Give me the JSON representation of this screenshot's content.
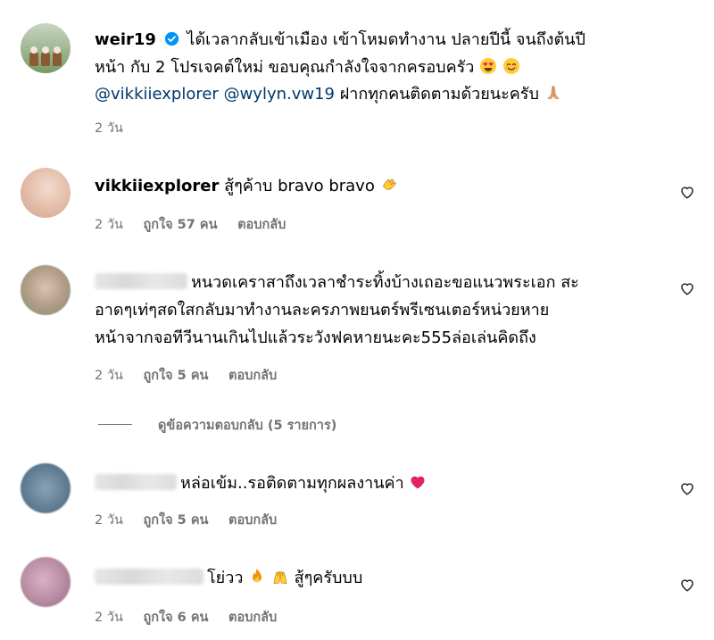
{
  "post": {
    "username": "weir19",
    "caption_line1": "ได้เวลากลับเข้าเมือง เข้าโหมดทำงาน ปลายปีนี้ จนถึงต้นปี",
    "caption_line2": "หน้า กับ 2 โปรเจคต์ใหม่ ขอบคุณกำลังใจจากครอบครัว",
    "mention1": "@vikkiiexplorer",
    "mention2": "@wylyn.vw19",
    "caption_line3_rest": "ฝากทุกคนติดตามด้วยนะครับ",
    "time": "2 วัน"
  },
  "comments": [
    {
      "username": "vikkiiexplorer",
      "text": "สู้ๆค้าบ bravo bravo",
      "time": "2 วัน",
      "likes": "ถูกใจ 57 คน",
      "reply": "ตอบกลับ"
    },
    {
      "text_line1": "หนวดเคราสาถึงเวลาชำระทิ้งบ้างเถอะขอแนวพระเอก สะ",
      "text_line2": "อาดๆเท่ๆสดใสกลับมาทำงานละครภาพยนตร์พรีเซนเตอร์หน่วยหาย",
      "text_line3": "หน้าจากจอทีวีนานเกินไปแล้วระวังฟคหายนะคะ555ล่อเล่นคิดถึง",
      "time": "2 วัน",
      "likes": "ถูกใจ 5 คน",
      "reply": "ตอบกลับ",
      "view_replies": "ดูข้อความตอบกลับ (5 รายการ)"
    },
    {
      "text": "หล่อเข้ม..รอติดตามทุกผลงานค่า",
      "time": "2 วัน",
      "likes": "ถูกใจ 5 คน",
      "reply": "ตอบกลับ"
    },
    {
      "text_a": "โย่วว",
      "text_b": "สู้ๆครับบบ",
      "time": "2 วัน",
      "likes": "ถูกใจ 6 คน",
      "reply": "ตอบกลับ"
    }
  ],
  "icons": [
    "verified-icon",
    "heart-icon",
    "heart-eyes-emoji",
    "smile-emoji",
    "pray-emoji",
    "clap-emoji",
    "red-heart-emoji",
    "fire-emoji",
    "raised-hands-emoji"
  ],
  "colors": {
    "mention": "#00376b",
    "meta": "#737373",
    "verified": "#0095f6"
  }
}
